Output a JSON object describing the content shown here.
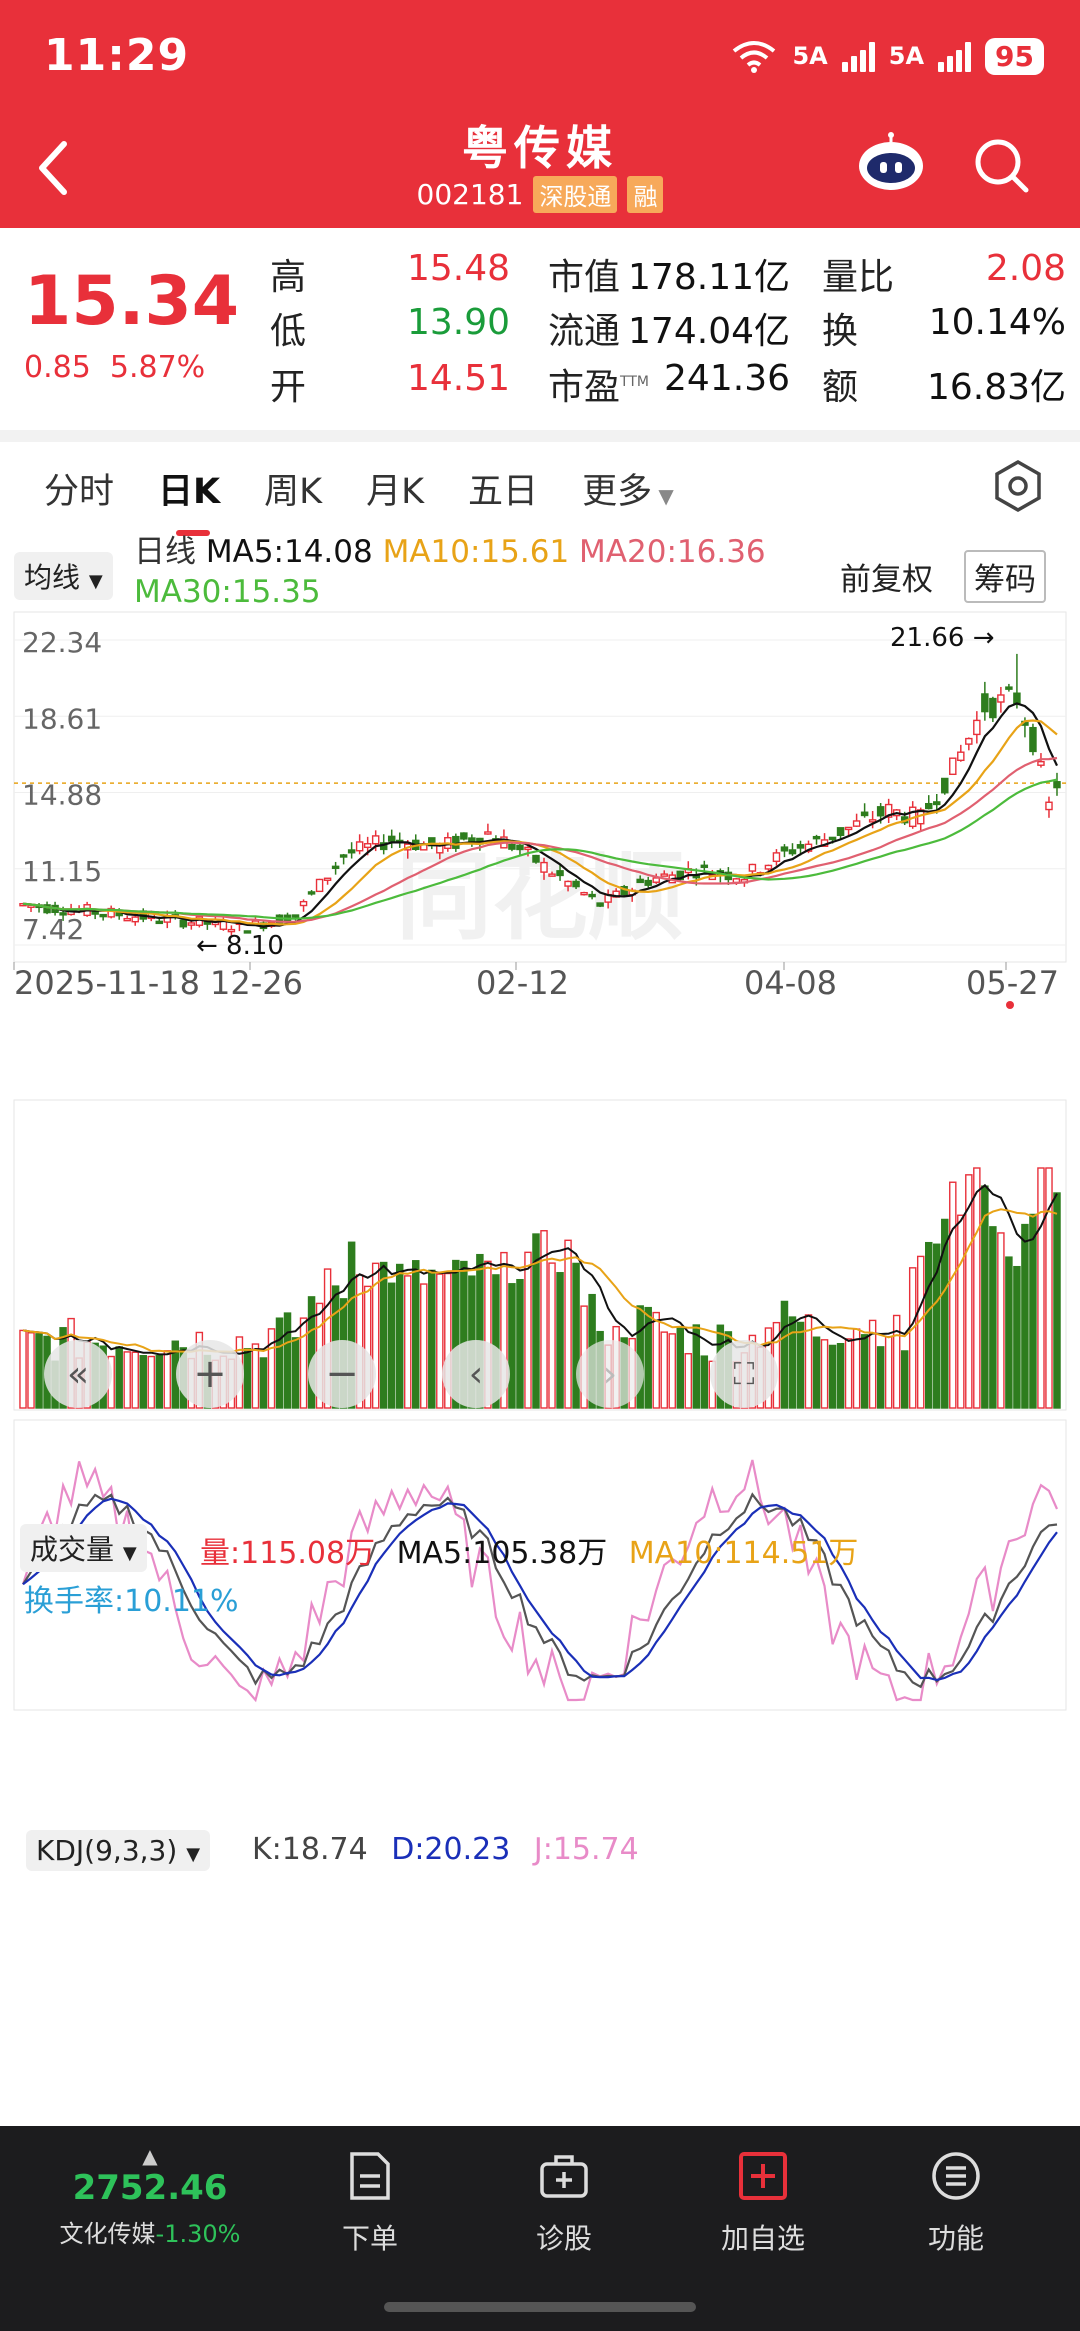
{
  "status_bar": {
    "time": "11:29",
    "net1": "6",
    "net2": "5A",
    "net3": "5A",
    "battery": "95"
  },
  "stock": {
    "name": "粤传媒",
    "code": "002181",
    "badge1": "深股通",
    "badge2": "融"
  },
  "quote": {
    "price": "15.34",
    "change": "0.85",
    "change_pct": "5.87%",
    "high_label": "高",
    "high": "15.48",
    "low_label": "低",
    "low": "13.90",
    "open_label": "开",
    "open": "14.51",
    "mktcap_label": "市值",
    "mktcap": "178.11亿",
    "float_label": "流通",
    "float": "174.04亿",
    "pe_label": "市盈",
    "pe_sup": "TTM",
    "pe": "241.36",
    "volratio_label": "量比",
    "volratio": "2.08",
    "turnover_label": "换",
    "turnover": "10.14%",
    "amount_label": "额",
    "amount": "16.83亿"
  },
  "tabs": [
    {
      "label": "分时"
    },
    {
      "label": "日K"
    },
    {
      "label": "周K"
    },
    {
      "label": "月K"
    },
    {
      "label": "五日"
    },
    {
      "label": "更多"
    }
  ],
  "ma_legend": {
    "selector": "均线",
    "period": "日线",
    "ma5": "MA5:14.08",
    "ma10": "MA10:15.61",
    "ma20": "MA20:16.36",
    "ma30": "MA30:15.35",
    "adjust": "前复权",
    "chips": "筹码"
  },
  "kline": {
    "y_ticks": [
      "22.34",
      "18.61",
      "14.88",
      "11.15",
      "7.42"
    ],
    "max_label": "21.66",
    "min_label": "8.10",
    "x_dates": [
      "2025-11-18",
      "12-26",
      "02-12",
      "04-08",
      "05-27"
    ],
    "watermark": "同花顺",
    "colors": {
      "up": "#e8303a",
      "down": "#2e7d1e",
      "ma5": "#111111",
      "ma10": "#e8a317",
      "ma20": "#e06070",
      "ma30": "#4cbb3c"
    }
  },
  "volume": {
    "selector": "成交量",
    "vol": "量:115.08万",
    "ma5": "MA5:105.38万",
    "ma10": "MA10:114.51万",
    "turnover": "换手率:10.11%"
  },
  "kdj": {
    "selector": "KDJ(9,3,3)",
    "k": "K:18.74",
    "d": "D:20.23",
    "j": "J:15.74"
  },
  "bottom": {
    "index_value": "2752.46",
    "index_name": "文化传媒",
    "index_change": "-1.30%",
    "order": "下单",
    "diagnose": "诊股",
    "add_watch": "加自选",
    "functions": "功能"
  },
  "chart_data": {
    "type": "candlestick",
    "y_axis_ticks": [
      22.34,
      18.61,
      14.88,
      11.15,
      7.42
    ],
    "ylim": [
      7.42,
      22.34
    ],
    "x_labels": [
      "2025-11-18",
      "12-26",
      "02-12",
      "04-08",
      "05-27"
    ],
    "series": [
      {
        "name": "MA5",
        "last": 14.08
      },
      {
        "name": "MA10",
        "last": 15.61
      },
      {
        "name": "MA20",
        "last": 16.36
      },
      {
        "name": "MA30",
        "last": 15.35
      }
    ],
    "highest": 21.66,
    "lowest": 8.1,
    "last_close": 15.34
  }
}
